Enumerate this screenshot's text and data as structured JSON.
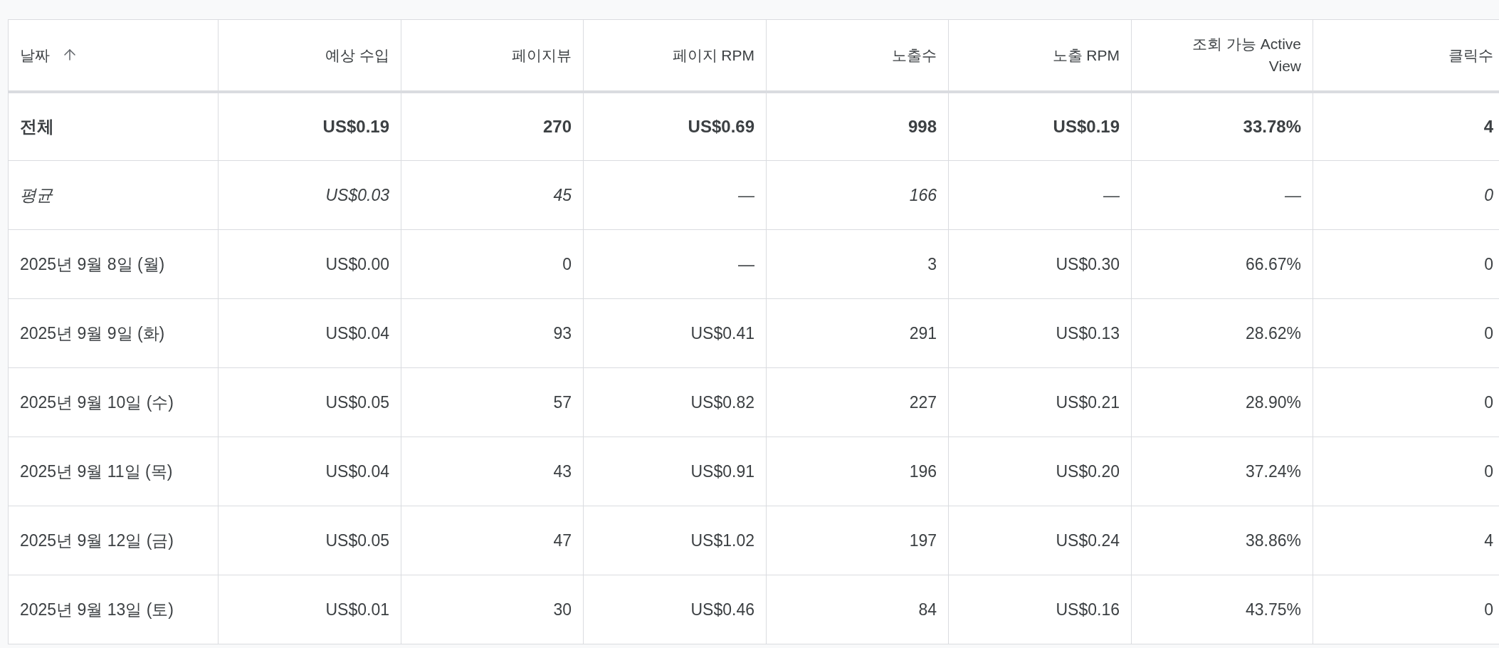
{
  "table": {
    "columns": [
      {
        "label": "날짜",
        "sorted": true
      },
      {
        "label": "예상 수입",
        "sorted": false
      },
      {
        "label": "페이지뷰",
        "sorted": false
      },
      {
        "label": "페이지 RPM",
        "sorted": false
      },
      {
        "label": "노출수",
        "sorted": false
      },
      {
        "label": "노출 RPM",
        "sorted": false
      },
      {
        "label": "조회 가능 Active View",
        "sorted": false
      },
      {
        "label": "클릭수",
        "sorted": false
      }
    ],
    "rows": [
      {
        "kind": "total",
        "cells": [
          "전체",
          "US$0.19",
          "270",
          "US$0.69",
          "998",
          "US$0.19",
          "33.78%",
          "4"
        ]
      },
      {
        "kind": "average",
        "cells": [
          "평균",
          "US$0.03",
          "45",
          "—",
          "166",
          "—",
          "—",
          "0"
        ]
      },
      {
        "kind": "day",
        "cells": [
          "2025년 9월 8일 (월)",
          "US$0.00",
          "0",
          "—",
          "3",
          "US$0.30",
          "66.67%",
          "0"
        ]
      },
      {
        "kind": "day",
        "cells": [
          "2025년 9월 9일 (화)",
          "US$0.04",
          "93",
          "US$0.41",
          "291",
          "US$0.13",
          "28.62%",
          "0"
        ]
      },
      {
        "kind": "day",
        "cells": [
          "2025년 9월 10일 (수)",
          "US$0.05",
          "57",
          "US$0.82",
          "227",
          "US$0.21",
          "28.90%",
          "0"
        ]
      },
      {
        "kind": "day",
        "cells": [
          "2025년 9월 11일 (목)",
          "US$0.04",
          "43",
          "US$0.91",
          "196",
          "US$0.20",
          "37.24%",
          "0"
        ]
      },
      {
        "kind": "day",
        "cells": [
          "2025년 9월 12일 (금)",
          "US$0.05",
          "47",
          "US$1.02",
          "197",
          "US$0.24",
          "38.86%",
          "4"
        ]
      },
      {
        "kind": "day",
        "cells": [
          "2025년 9월 13일 (토)",
          "US$0.01",
          "30",
          "US$0.46",
          "84",
          "US$0.16",
          "43.75%",
          "0"
        ]
      }
    ]
  }
}
